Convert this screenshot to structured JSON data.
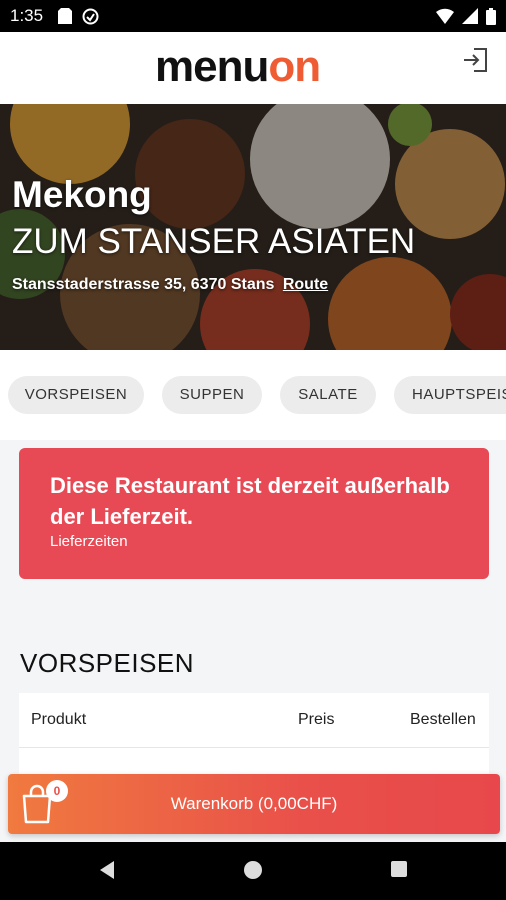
{
  "status_bar": {
    "time": "1:35"
  },
  "header": {
    "logo_part1": "menu",
    "logo_part2": "on"
  },
  "restaurant": {
    "name": "Mekong",
    "subtitle": "ZUM STANSER ASIATEN",
    "address": "Stansstaderstrasse 35, 6370 Stans",
    "route_label": "Route"
  },
  "categories": [
    "VORSPEISEN",
    "SUPPEN",
    "SALATE",
    "HAUPTSPEISEN"
  ],
  "alert": {
    "message": "Diese Restaurant ist derzeit außerhalb der Lieferzeit.",
    "link": "Lieferzeiten"
  },
  "section": {
    "title": "VORSPEISEN",
    "columns": [
      "Produkt",
      "Preis",
      "Bestellen"
    ]
  },
  "cart": {
    "label": "Warenkorb (0,00CHF)",
    "count": "0"
  },
  "colors": {
    "brand_orange": "#ef5b33",
    "alert_red": "#e84a55"
  }
}
